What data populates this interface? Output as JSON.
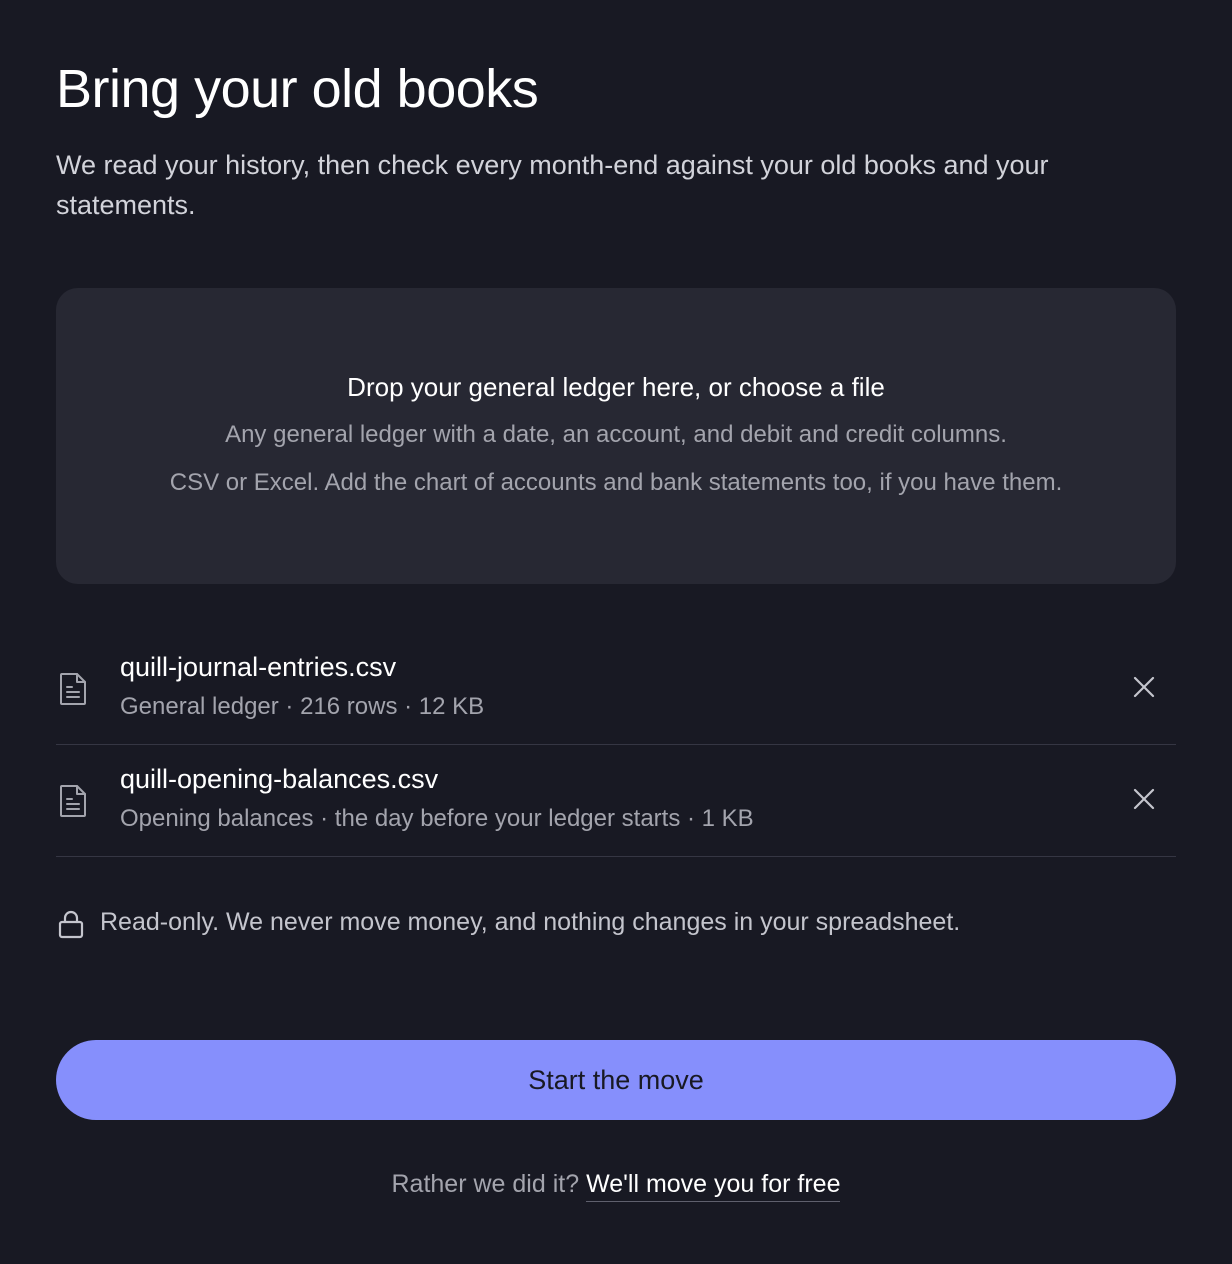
{
  "header": {
    "title": "Bring your old books",
    "subtitle": "We read your history, then check every month-end against your old books and your statements."
  },
  "dropzone": {
    "title": "Drop your general ledger here, or choose a file",
    "line1": "Any general ledger with a date, an account, and debit and credit columns.",
    "line2": "CSV or Excel. Add the chart of accounts and bank statements too, if you have them."
  },
  "files": [
    {
      "name": "quill-journal-entries.csv",
      "meta": "General ledger · 216 rows · 12 KB",
      "icon": "file-icon",
      "remove_icon": "close-icon"
    },
    {
      "name": "quill-opening-balances.csv",
      "meta": "Opening balances · the day before your ledger starts · 1 KB",
      "icon": "file-icon",
      "remove_icon": "close-icon"
    }
  ],
  "notice": {
    "icon": "lock-icon",
    "text": "Read-only. We never move money, and nothing changes in your spreadsheet."
  },
  "cta": {
    "label": "Start the move"
  },
  "footer": {
    "prompt": "Rather we did it?",
    "link": "We'll move you for free"
  },
  "colors": {
    "background": "#181923",
    "surface": "#272833",
    "accent": "#868ffc",
    "text_primary": "#ffffff",
    "text_muted": "#a3a4ad",
    "divider": "#353643"
  }
}
